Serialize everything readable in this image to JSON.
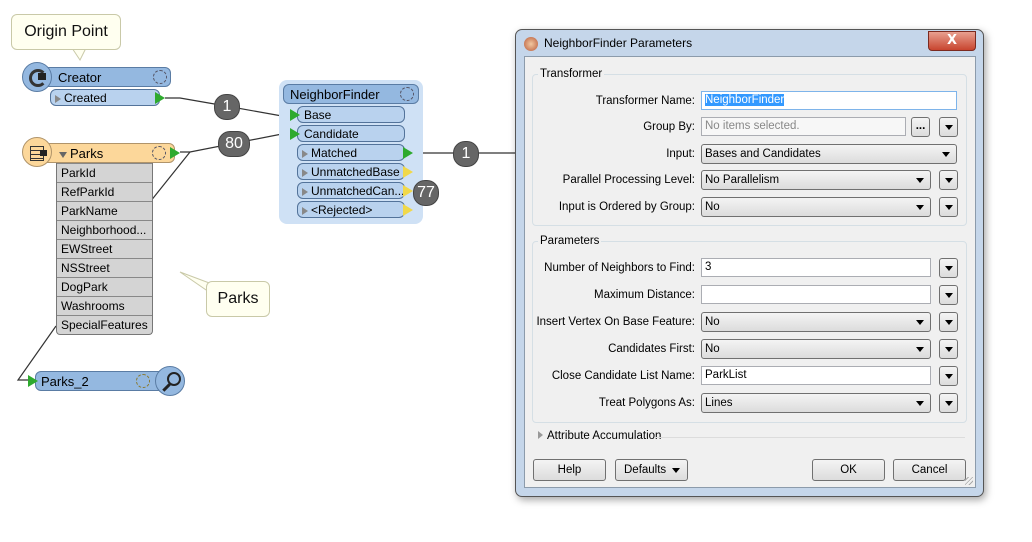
{
  "canvas": {
    "annotations": {
      "origin_point": "Origin Point",
      "parks": "Parks"
    },
    "creator": {
      "name": "Creator",
      "output_port": "Created"
    },
    "parks_reader": {
      "name": "Parks",
      "attributes": [
        "ParkId",
        "RefParkId",
        "ParkName",
        "Neighborhood...",
        "EWStreet",
        "NSStreet",
        "DogPark",
        "Washrooms",
        "SpecialFeatures"
      ]
    },
    "parks_2": {
      "name": "Parks_2"
    },
    "neighborfinder": {
      "name": "NeighborFinder",
      "inputs": [
        "Base",
        "Candidate"
      ],
      "outputs": [
        "Matched",
        "UnmatchedBase",
        "UnmatchedCan...",
        "<Rejected>"
      ]
    },
    "counts": {
      "created_to_base": "1",
      "parks_to_candidate": "80",
      "matched": "1",
      "unmatched_candidate": "77"
    }
  },
  "dialog": {
    "title": "NeighborFinder Parameters",
    "close_label": "X",
    "transformer_group": {
      "label": "Transformer",
      "transformer_name_label": "Transformer Name:",
      "transformer_name_value": "NeighborFinder",
      "group_by_label": "Group By:",
      "group_by_placeholder": "No items selected.",
      "group_by_browse": "...",
      "input_label": "Input:",
      "input_value": "Bases and Candidates",
      "parallel_label": "Parallel Processing Level:",
      "parallel_value": "No Parallelism",
      "ordered_label": "Input is Ordered by Group:",
      "ordered_value": "No"
    },
    "parameters_group": {
      "label": "Parameters",
      "neighbors_label": "Number of Neighbors to Find:",
      "neighbors_value": "3",
      "max_distance_label": "Maximum Distance:",
      "max_distance_value": "",
      "insert_vertex_label": "Insert Vertex On Base Feature:",
      "insert_vertex_value": "No",
      "candidates_first_label": "Candidates First:",
      "candidates_first_value": "No",
      "list_name_label": "Close Candidate List Name:",
      "list_name_value": "ParkList",
      "treat_polygons_label": "Treat Polygons As:",
      "treat_polygons_value": "Lines"
    },
    "attribute_accumulation": "Attribute Accumulation",
    "buttons": {
      "help": "Help",
      "defaults": "Defaults",
      "ok": "OK",
      "cancel": "Cancel"
    }
  }
}
